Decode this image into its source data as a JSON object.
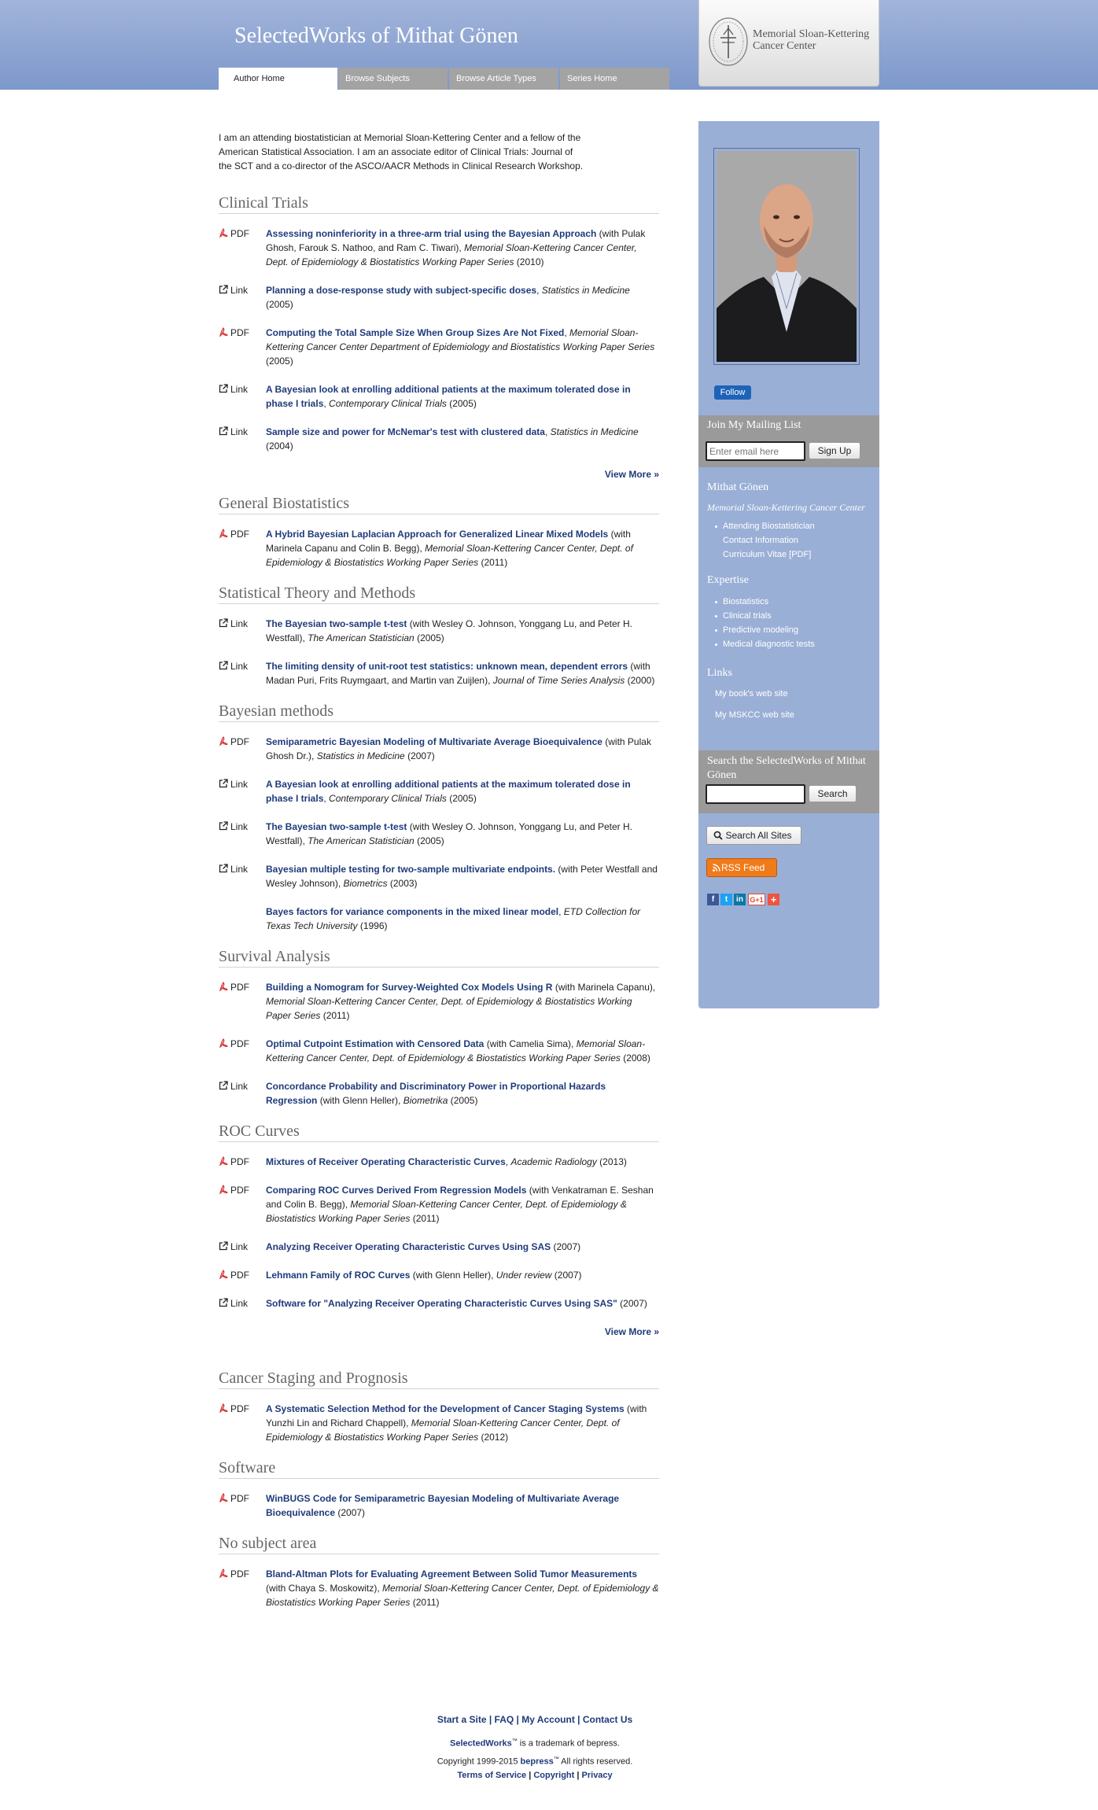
{
  "header": {
    "site_title": "SelectedWorks of Mithat Gönen",
    "tabs": [
      {
        "label": "Author Home"
      },
      {
        "label": "Browse Subjects"
      },
      {
        "label": "Browse Article Types"
      },
      {
        "label": "Series Home"
      }
    ],
    "logo_text": "Memorial Sloan-Kettering Cancer Center"
  },
  "intro": "I am an attending biostatistician at Memorial Sloan-Kettering Center and a fellow of the American Statistical Association. I am an associate editor of Clinical Trials: Journal of the SCT and a co-director of the ASCO/AACR Methods in Clinical Research Workshop.",
  "sections": [
    {
      "title": "Clinical Trials",
      "view_more": "View More »",
      "entries": [
        {
          "type": "PDF",
          "title": "Assessing noninferiority in a three-arm trial using the Bayesian Approach",
          "authors": " (with Pulak Ghosh, Farouk S. Nathoo, and Ram C. Tiwari), ",
          "venue": "Memorial Sloan-Kettering Cancer Center, Dept. of Epidemiology & Biostatistics Working Paper Series",
          "year": " (2010)"
        },
        {
          "type": "Link",
          "title": "Planning a dose-response study with subject-specific doses",
          "authors": ", ",
          "venue": "Statistics in Medicine",
          "year": " (2005)"
        },
        {
          "type": "PDF",
          "title": "Computing the Total Sample Size When Group Sizes Are Not Fixed",
          "authors": ", ",
          "venue": "Memorial Sloan-Kettering Cancer Center Department of Epidemiology and Biostatistics Working Paper Series",
          "year": " (2005)"
        },
        {
          "type": "Link",
          "title": "A Bayesian look at enrolling additional patients at the maximum tolerated dose in phase I trials",
          "authors": ", ",
          "venue": "Contemporary Clinical Trials",
          "year": " (2005)"
        },
        {
          "type": "Link",
          "title": "Sample size and power for McNemar's test with clustered data",
          "authors": ", ",
          "venue": "Statistics in Medicine",
          "year": " (2004)"
        }
      ]
    },
    {
      "title": "General Biostatistics",
      "entries": [
        {
          "type": "PDF",
          "title": "A Hybrid Bayesian Laplacian Approach for Generalized Linear Mixed Models",
          "authors": " (with Marinela Capanu and Colin B. Begg), ",
          "venue": "Memorial Sloan-Kettering Cancer Center, Dept. of Epidemiology & Biostatistics Working Paper Series",
          "year": " (2011)"
        }
      ]
    },
    {
      "title": "Statistical Theory and Methods",
      "entries": [
        {
          "type": "Link",
          "title": "The Bayesian two-sample t-test",
          "authors": " (with Wesley O. Johnson, Yonggang Lu, and Peter H. Westfall), ",
          "venue": "The American Statistician",
          "year": " (2005)"
        },
        {
          "type": "Link",
          "title": "The limiting density of unit-root test statistics: unknown mean, dependent errors",
          "authors": " (with Madan Puri, Frits Ruymgaart, and Martin van Zuijlen), ",
          "venue": "Journal of Time Series Analysis",
          "year": " (2000)"
        }
      ]
    },
    {
      "title": "Bayesian methods",
      "entries": [
        {
          "type": "PDF",
          "title": "Semiparametric Bayesian Modeling of Multivariate Average Bioequivalence",
          "authors": " (with Pulak Ghosh Dr.), ",
          "venue": "Statistics in Medicine",
          "year": " (2007)"
        },
        {
          "type": "Link",
          "title": "A Bayesian look at enrolling additional patients at the maximum tolerated dose in phase I trials",
          "authors": ", ",
          "venue": "Contemporary Clinical Trials",
          "year": " (2005)"
        },
        {
          "type": "Link",
          "title": "The Bayesian two-sample t-test",
          "authors": " (with Wesley O. Johnson, Yonggang Lu, and Peter H. Westfall), ",
          "venue": "The American Statistician",
          "year": " (2005)"
        },
        {
          "type": "Link",
          "title": "Bayesian multiple testing for two-sample multivariate endpoints.",
          "authors": " (with Peter Westfall and Wesley Johnson), ",
          "venue": "Biometrics",
          "year": " (2003)"
        },
        {
          "type": "",
          "title": "Bayes factors for variance components in the mixed linear model",
          "authors": ", ",
          "venue": "ETD Collection for Texas Tech University",
          "year": " (1996)"
        }
      ]
    },
    {
      "title": "Survival Analysis",
      "entries": [
        {
          "type": "PDF",
          "title": "Building a Nomogram for Survey-Weighted Cox Models Using R",
          "authors": " (with Marinela Capanu), ",
          "venue": "Memorial Sloan-Kettering Cancer Center, Dept. of Epidemiology & Biostatistics Working Paper Series",
          "year": " (2011)"
        },
        {
          "type": "PDF",
          "title": "Optimal Cutpoint Estimation with Censored Data",
          "authors": " (with Camelia Sima), ",
          "venue": "Memorial Sloan-Kettering Cancer Center, Dept. of Epidemiology & Biostatistics Working Paper Series",
          "year": " (2008)"
        },
        {
          "type": "Link",
          "title": "Concordance Probability and Discriminatory Power in Proportional Hazards Regression",
          "authors": " (with Glenn Heller), ",
          "venue": "Biometrika",
          "year": " (2005)"
        }
      ]
    },
    {
      "title": "ROC Curves",
      "view_more": "View More »",
      "entries": [
        {
          "type": "PDF",
          "title": "Mixtures of Receiver Operating Characteristic Curves",
          "authors": ", ",
          "venue": "Academic Radiology",
          "year": " (2013)"
        },
        {
          "type": "PDF",
          "title": "Comparing ROC Curves Derived From Regression Models",
          "authors": " (with Venkatraman E. Seshan and Colin B. Begg), ",
          "venue": "Memorial Sloan-Kettering Cancer Center, Dept. of Epidemiology & Biostatistics Working Paper Series",
          "year": " (2011)"
        },
        {
          "type": "Link",
          "title": "Analyzing Receiver Operating Characteristic Curves Using SAS",
          "authors": "",
          "venue": "",
          "year": " (2007)"
        },
        {
          "type": "PDF",
          "title": "Lehmann Family of ROC Curves",
          "authors": " (with Glenn Heller), ",
          "venue": "Under review",
          "year": " (2007)"
        },
        {
          "type": "Link",
          "title": "Software for \"Analyzing Receiver Operating Characteristic Curves Using SAS\"",
          "authors": "",
          "venue": "",
          "year": " (2007)"
        }
      ]
    },
    {
      "title": "Cancer Staging and Prognosis",
      "entries": [
        {
          "type": "PDF",
          "title": "A Systematic Selection Method for the Development of Cancer Staging Systems",
          "authors": " (with Yunzhi Lin and Richard Chappell), ",
          "venue": "Memorial Sloan-Kettering Cancer Center, Dept. of Epidemiology & Biostatistics Working Paper Series",
          "year": " (2012)"
        }
      ]
    },
    {
      "title": "Software",
      "entries": [
        {
          "type": "PDF",
          "title": "WinBUGS Code for Semiparametric Bayesian Modeling of Multivariate Average Bioequivalence",
          "authors": "",
          "venue": "",
          "year": " (2007)"
        }
      ]
    },
    {
      "title": "No subject area",
      "entries": [
        {
          "type": "PDF",
          "title": "Bland-Altman Plots for Evaluating Agreement Between Solid Tumor Measurements",
          "authors": " (with Chaya S. Moskowitz), ",
          "venue": "Memorial Sloan-Kettering Cancer Center, Dept. of Epidemiology & Biostatistics Working Paper Series",
          "year": " (2011)"
        }
      ]
    }
  ],
  "sidebar": {
    "follow_label": "Follow",
    "mailing": {
      "title": "Join My Mailing List",
      "placeholder": "Enter email here",
      "button": "Sign Up"
    },
    "profile": {
      "name": "Mithat Gönen",
      "org": "Memorial Sloan-Kettering Cancer Center",
      "items": [
        "Attending Biostatistician",
        "Contact Information",
        "Curriculum Vitae [PDF]"
      ]
    },
    "expertise": {
      "title": "Expertise",
      "items": [
        "Biostatistics",
        "Clinical trials",
        "Predictive modeling",
        "Medical diagnostic tests"
      ]
    },
    "links": {
      "title": "Links",
      "items": [
        "My book's web site",
        "My MSKCC web site"
      ]
    },
    "search": {
      "title": "Search the SelectedWorks of Mithat Gönen",
      "button": "Search"
    },
    "search_all": "Search All Sites",
    "rss": "RSS Feed",
    "share": [
      {
        "icon": "facebook-icon",
        "label": "f",
        "color": "#3b5998"
      },
      {
        "icon": "twitter-icon",
        "label": "t",
        "color": "#1da1f2"
      },
      {
        "icon": "linkedin-icon",
        "label": "in",
        "color": "#0e76a8"
      },
      {
        "icon": "googleplus-icon",
        "label": "G+1",
        "color": "#dd4b39"
      },
      {
        "icon": "addthis-icon",
        "label": "+",
        "color": "#f0533f"
      }
    ]
  },
  "footer": {
    "links": [
      "Start a Site",
      "FAQ",
      "My Account",
      "Contact Us"
    ],
    "brand": "SelectedWorks",
    "tm_text": " is a trademark of bepress.",
    "copyright_pre": "Copyright 1999-2015 ",
    "bepress": "bepress",
    "copyright_post": " All rights reserved.",
    "legal": [
      "Terms of Service",
      "Copyright",
      "Privacy"
    ]
  },
  "colors": {
    "header_top": "#a2b4da",
    "header_bottom": "#7d98cb",
    "link": "#1f3b7a",
    "sidebar": "#9aafd6",
    "rss": "#ef7b1a"
  }
}
